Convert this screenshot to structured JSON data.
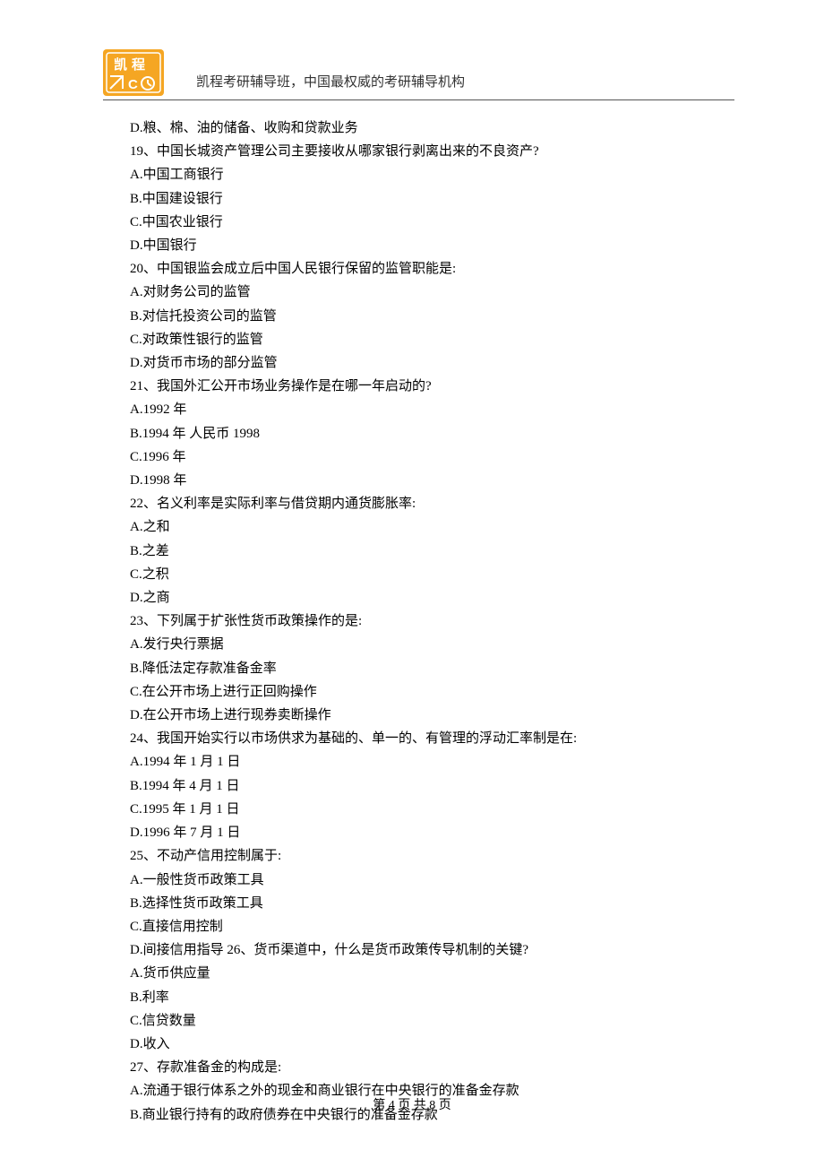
{
  "header": {
    "text": "凯程考研辅导班，中国最权威的考研辅导机构"
  },
  "lines": [
    "D.粮、棉、油的储备、收购和贷款业务",
    "19、中国长城资产管理公司主要接收从哪家银行剥离出来的不良资产?",
    "A.中国工商银行",
    "B.中国建设银行",
    "C.中国农业银行",
    "D.中国银行",
    "20、中国银监会成立后中国人民银行保留的监管职能是:",
    "A.对财务公司的监管",
    "B.对信托投资公司的监管",
    "C.对政策性银行的监管",
    "D.对货币市场的部分监管",
    "21、我国外汇公开市场业务操作是在哪一年启动的?",
    "A.1992 年",
    "B.1994 年  人民币 1998",
    "C.1996 年",
    "D.1998 年",
    "22、名义利率是实际利率与借贷期内通货膨胀率:",
    "A.之和",
    "B.之差",
    "C.之积",
    "D.之商",
    "23、下列属于扩张性货币政策操作的是:",
    "A.发行央行票据",
    "B.降低法定存款准备金率",
    "C.在公开市场上进行正回购操作",
    "D.在公开市场上进行现券卖断操作",
    "24、我国开始实行以市场供求为基础的、单一的、有管理的浮动汇率制是在:",
    "A.1994 年 1 月 1 日",
    "B.1994 年 4 月 1 日",
    "C.1995 年 1 月 1 日",
    "D.1996 年 7 月 1 日",
    "25、不动产信用控制属于:",
    "A.一般性货币政策工具",
    "B.选择性货币政策工具",
    "C.直接信用控制",
    "D.间接信用指导 26、货币渠道中，什么是货币政策传导机制的关键?",
    "A.货币供应量",
    "B.利率",
    "C.信贷数量",
    "D.收入",
    "27、存款准备金的构成是:",
    "A.流通于银行体系之外的现金和商业银行在中央银行的准备金存款",
    "B.商业银行持有的政府债券在中央银行的准备金存款"
  ],
  "footer": {
    "page_label": "第 4 页 共 8 页"
  }
}
